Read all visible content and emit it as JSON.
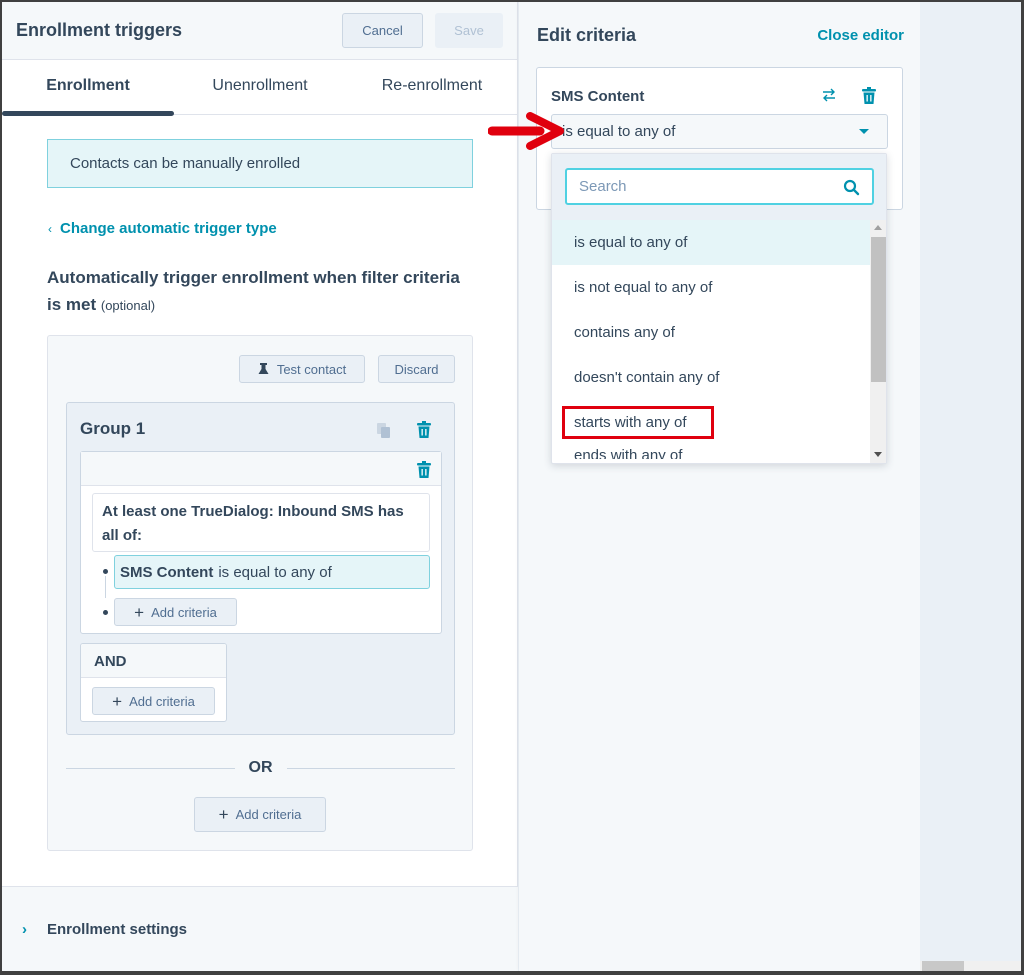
{
  "header": {
    "title": "Enrollment triggers",
    "cancel_label": "Cancel",
    "save_label": "Save"
  },
  "tabs": [
    {
      "label": "Enrollment",
      "active": true
    },
    {
      "label": "Unenrollment",
      "active": false
    },
    {
      "label": "Re-enrollment",
      "active": false
    }
  ],
  "notice": "Contacts can be manually enrolled",
  "change_trigger_link": "Change automatic trigger type",
  "auto_heading": {
    "text": "Automatically trigger enrollment when filter criteria is met",
    "optional": "(optional)"
  },
  "filter": {
    "test_contact_label": "Test contact",
    "discard_label": "Discard",
    "group": {
      "title": "Group 1",
      "object_text": "At least one TrueDialog: Inbound SMS has all of:",
      "criterion": {
        "property": "SMS Content",
        "operator": "is equal to any of"
      },
      "add_criteria_label": "Add criteria"
    },
    "and_label": "AND",
    "and_add_criteria_label": "Add criteria",
    "or_label": "OR",
    "or_add_criteria_label": "Add criteria"
  },
  "enrollment_settings_label": "Enrollment settings",
  "editor": {
    "title": "Edit criteria",
    "close_label": "Close editor",
    "property": "SMS Content",
    "operator_selected": "is equal to any of",
    "search_placeholder": "Search",
    "options": [
      {
        "label": "is equal to any of",
        "selected": true,
        "highlighted": false
      },
      {
        "label": "is not equal to any of",
        "selected": false,
        "highlighted": false
      },
      {
        "label": "contains any of",
        "selected": false,
        "highlighted": false
      },
      {
        "label": "doesn't contain any of",
        "selected": false,
        "highlighted": false
      },
      {
        "label": "starts with any of",
        "selected": false,
        "highlighted": true
      },
      {
        "label": "ends with any of",
        "selected": false,
        "highlighted": false
      }
    ]
  },
  "colors": {
    "accent": "#0091ae",
    "text": "#33475b",
    "annotation_red": "#e0000e",
    "selected_bg": "#e5f5f8"
  }
}
